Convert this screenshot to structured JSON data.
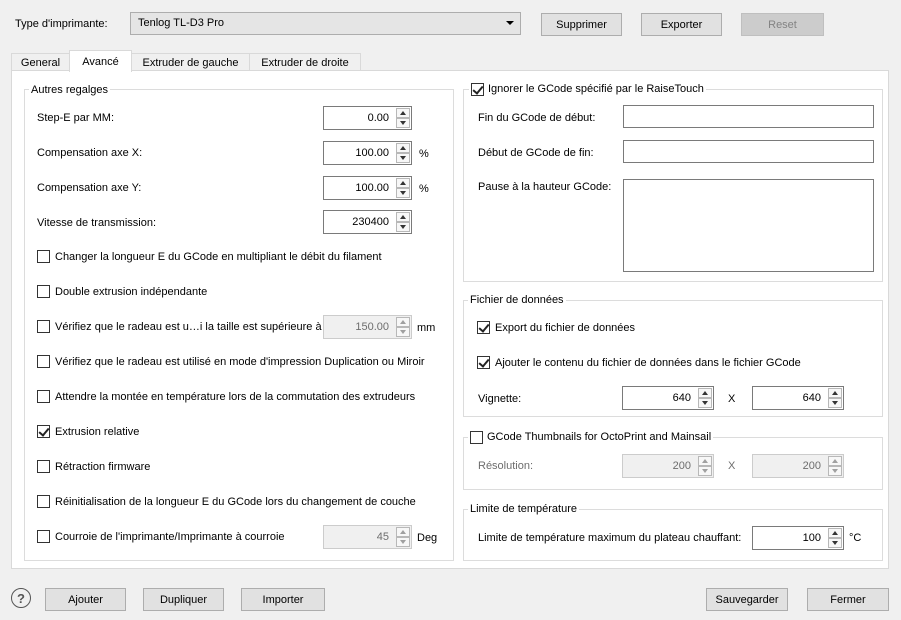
{
  "header": {
    "printer_type_label": "Type d'imprimante:",
    "printer_type_value": "Tenlog TL-D3 Pro",
    "delete_label": "Supprimer",
    "export_label": "Exporter",
    "reset_label": "Reset"
  },
  "tabs": [
    {
      "label": "General"
    },
    {
      "label": "Avancé"
    },
    {
      "label": "Extruder de gauche"
    },
    {
      "label": "Extruder de droite"
    }
  ],
  "other_settings": {
    "title": "Autres regalges",
    "step_e_label": "Step-E par MM:",
    "step_e_value": "0.00",
    "comp_x_label": "Compensation axe X:",
    "comp_x_value": "100.00",
    "comp_x_unit": "%",
    "comp_y_label": "Compensation axe Y:",
    "comp_y_value": "100.00",
    "comp_y_unit": "%",
    "baud_label": "Vitesse de transmission:",
    "baud_value": "230400",
    "options": [
      {
        "label": "Changer la longueur E du GCode en multipliant le débit du filament",
        "checked": false
      },
      {
        "label": "Double extrusion indépendante",
        "checked": false
      },
      {
        "label": "Vérifiez que le radeau est u…i la taille est supérieure à",
        "checked": false
      },
      {
        "label": "Vérifiez que le radeau est utilisé en mode d'impression Duplication ou Miroir",
        "checked": false
      },
      {
        "label": "Attendre la montée en température lors de la commutation des extrudeurs",
        "checked": false
      },
      {
        "label": "Extrusion relative",
        "checked": true
      },
      {
        "label": "Rétraction firmware",
        "checked": false
      },
      {
        "label": "Réinitialisation de la longueur E du GCode lors du changement de couche",
        "checked": false
      },
      {
        "label": "Courroie de l'imprimante/Imprimante à courroie",
        "checked": false
      }
    ],
    "raft_size_value": "150.00",
    "raft_size_unit": "mm",
    "belt_value": "45",
    "belt_unit": "Deg"
  },
  "raisetouch": {
    "title": "Ignorer le GCode spécifié par le RaiseTouch",
    "checked": true,
    "start_end_label": "Fin du GCode de début:",
    "end_start_label": "Début de GCode de fin:",
    "pause_label": "Pause à la hauteur GCode:"
  },
  "data_file": {
    "title": "Fichier de données",
    "export_label": "Export du fichier de données",
    "export_checked": true,
    "append_label": "Ajouter le contenu du fichier de données dans le fichier GCode",
    "append_checked": true,
    "thumbnail_label": "Vignette:",
    "thumb_w": "640",
    "thumb_x": "X",
    "thumb_h": "640"
  },
  "octoprint": {
    "title": "GCode Thumbnails for OctoPrint and Mainsail",
    "checked": false,
    "resolution_label": "Résolution:",
    "res_w": "200",
    "res_x": "X",
    "res_h": "200"
  },
  "temp_limit": {
    "title": "Limite de température",
    "label": "Limite de température maximum du plateau chauffant:",
    "value": "100",
    "unit": "°C"
  },
  "footer": {
    "help_symbol": "?",
    "add_label": "Ajouter",
    "duplicate_label": "Dupliquer",
    "import_label": "Importer",
    "save_label": "Sauvegarder",
    "close_label": "Fermer"
  }
}
